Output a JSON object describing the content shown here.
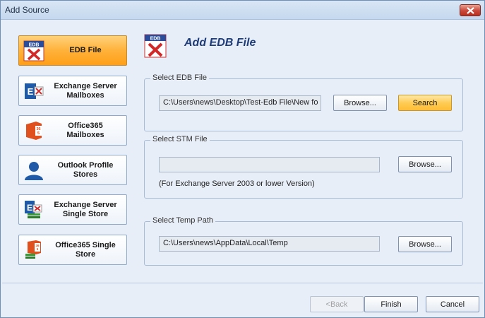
{
  "window": {
    "title": "Add Source"
  },
  "sidebar": {
    "items": [
      {
        "label": "EDB File",
        "icon": "edb-file-icon",
        "active": true
      },
      {
        "label": "Exchange Server\nMailboxes",
        "icon": "exchange-server-icon",
        "active": false
      },
      {
        "label": "Office365\nMailboxes",
        "icon": "office365-icon",
        "active": false
      },
      {
        "label": "Outlook Profile\nStores",
        "icon": "outlook-profile-icon",
        "active": false
      },
      {
        "label": "Exchange Server\nSingle Store",
        "icon": "exchange-single-store-icon",
        "active": false
      },
      {
        "label": "Office365 Single\nStore",
        "icon": "office365-single-store-icon",
        "active": false
      }
    ]
  },
  "main": {
    "title": "Add EDB File",
    "edb_group": {
      "legend": "Select EDB File",
      "path_value": "C:\\Users\\news\\Desktop\\Test-Edb File\\New fo",
      "browse_label": "Browse...",
      "search_label": "Search"
    },
    "stm_group": {
      "legend": "Select STM File",
      "path_value": "",
      "browse_label": "Browse...",
      "note": "(For Exchange Server 2003 or lower Version)"
    },
    "temp_group": {
      "legend": "Select Temp Path",
      "path_value": "C:\\Users\\news\\AppData\\Local\\Temp",
      "browse_label": "Browse..."
    }
  },
  "footer": {
    "back_label": "<Back",
    "finish_label": "Finish",
    "cancel_label": "Cancel"
  },
  "colors": {
    "active_nav": "#ffb23a",
    "accent_title": "#1f3d78",
    "edb_red": "#d22828"
  }
}
